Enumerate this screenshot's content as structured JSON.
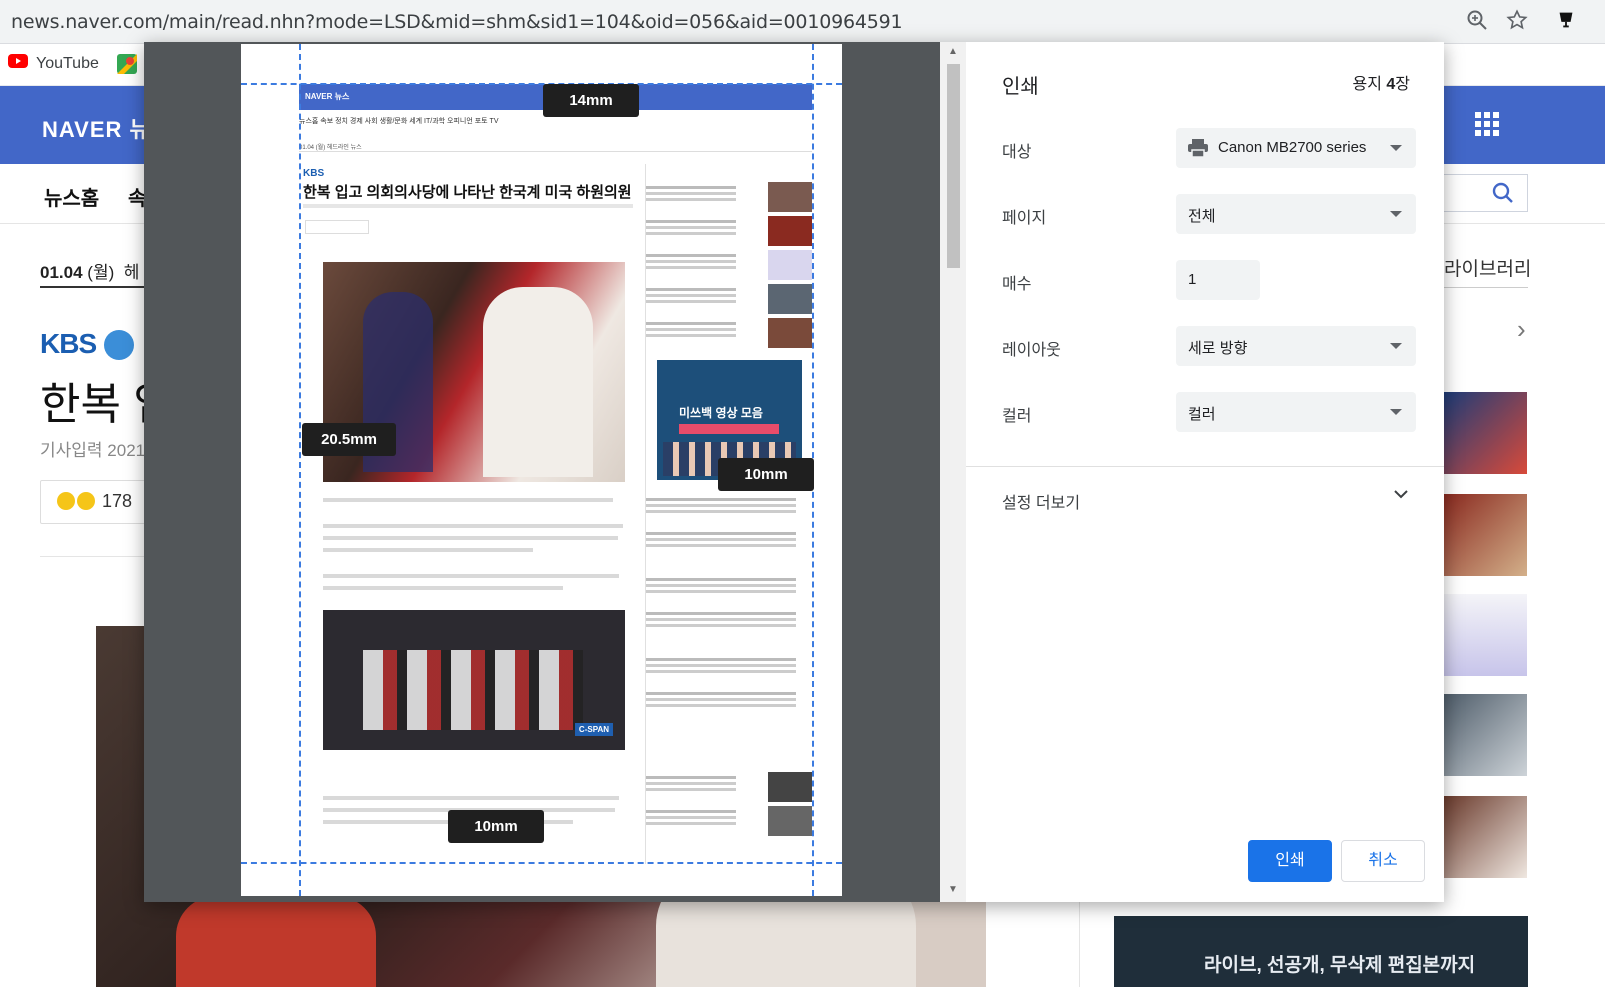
{
  "browser": {
    "url": "news.naver.com/main/read.nhn?mode=LSD&mid=shm&sid1=104&oid=056&aid=0010964591",
    "bookmarks": [
      {
        "label": "YouTube"
      }
    ]
  },
  "background_page": {
    "logo": "NAVER 뉴",
    "nav_home": "뉴스홈",
    "nav_next": "속",
    "date": "01.04",
    "date_day": "(월)",
    "date_suffix": "헤",
    "library": "라이브러리",
    "press": "KBS",
    "headline": "한복 입",
    "reporter": "기사입력 2021",
    "reaction_count": "178",
    "banner_text": "라이브, 선공개, 무삭제 편집본까지"
  },
  "print_dialog": {
    "title": "인쇄",
    "sheet_count_prefix": "용지 ",
    "sheet_count": "4",
    "sheet_count_suffix": "장",
    "settings": {
      "destination": {
        "label": "대상",
        "value": "Canon MB2700 series"
      },
      "pages": {
        "label": "페이지",
        "value": "전체"
      },
      "copies": {
        "label": "매수",
        "value": "1"
      },
      "layout": {
        "label": "레이아웃",
        "value": "세로 방향"
      },
      "color": {
        "label": "컬러",
        "value": "컬러"
      }
    },
    "more_settings": "설정 더보기",
    "print_button": "인쇄",
    "cancel_button": "취소"
  },
  "preview": {
    "margin_top": "14mm",
    "margin_left": "20.5mm",
    "margin_right": "10mm",
    "margin_bottom": "10mm",
    "mini_logo": "NAVER 뉴스",
    "mini_nav": "뉴스홈   속보   정치   경제   사회   생활/문화   세계   IT/과학   오피니언   포토   TV",
    "mini_sub": "01.04 (월)   헤드라인 뉴스",
    "mini_press": "KBS",
    "mini_title": "한복 입고 의회의사당에 나타난 한국계 미국 하원의원",
    "mini_banner": "미쓰백 영상 모음",
    "mini_cspan": "C-SPAN"
  },
  "colors": {
    "naver_blue": "#4267c8",
    "primary_button": "#1a73e8",
    "guide_blue": "#3c7be0"
  },
  "icons": [
    "zoom-icon",
    "star-icon",
    "extension-icon",
    "youtube-icon",
    "maps-icon",
    "grid-icon",
    "search-icon",
    "printer-icon",
    "chevron-down-icon"
  ]
}
